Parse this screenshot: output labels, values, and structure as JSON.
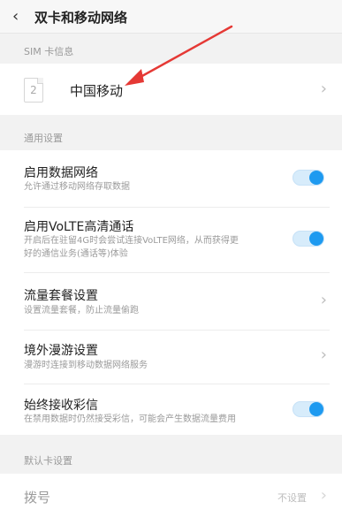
{
  "header": {
    "title": "双卡和移动网络",
    "back_icon": "chevron-left-icon"
  },
  "sim_section": {
    "label": "SIM 卡信息",
    "sim_slot": "2",
    "carrier": "中国移动"
  },
  "general_section": {
    "label": "通用设置",
    "items": [
      {
        "title": "启用数据网络",
        "subtitle": "允许通过移动网络存取数据",
        "control": "toggle",
        "on": true
      },
      {
        "title": "启用VoLTE高清通话",
        "subtitle_line1": "开启后在驻留4G时会尝试连接VoLTE网络，从而获得更",
        "subtitle_line2": "好的通信业务(通话等)体验",
        "control": "toggle",
        "on": true
      },
      {
        "title": "流量套餐设置",
        "subtitle": "设置流量套餐，防止流量偷跑",
        "control": "chevron"
      },
      {
        "title": "境外漫游设置",
        "subtitle": "漫游时连接到移动数据网络服务",
        "control": "chevron"
      },
      {
        "title": "始终接收彩信",
        "subtitle": "在禁用数据时仍然接受彩信，可能会产生数据流量费用",
        "control": "toggle",
        "on": true
      }
    ]
  },
  "default_section": {
    "label": "默认卡设置",
    "dial": {
      "title": "拨号",
      "value": "不设置"
    }
  },
  "colors": {
    "accent": "#1e9af0",
    "annotation": "#e53935"
  }
}
